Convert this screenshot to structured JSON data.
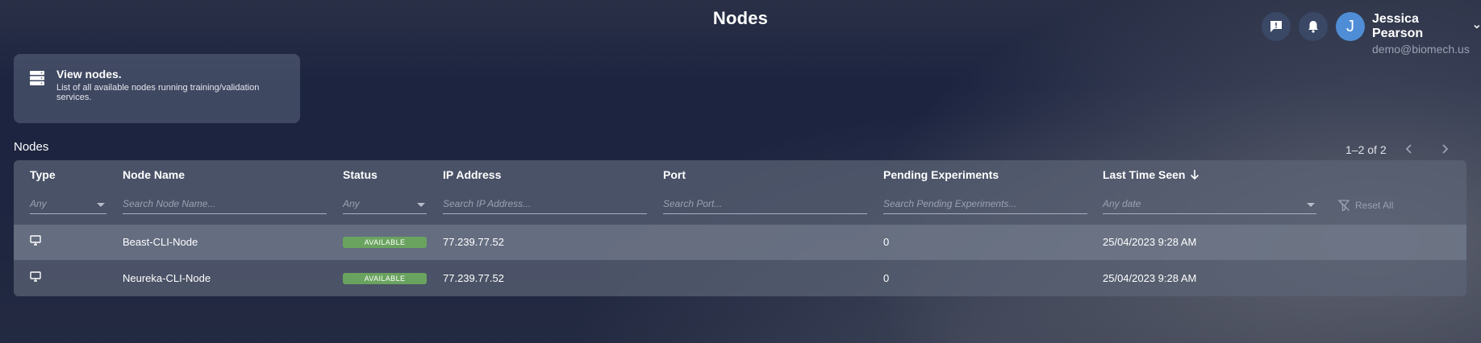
{
  "header": {
    "title": "Nodes",
    "user": {
      "name": "Jessica Pearson",
      "email": "demo@biomech.us",
      "initial": "J"
    }
  },
  "info_card": {
    "title": "View nodes.",
    "description": "List of all available nodes running training/validation services."
  },
  "section": {
    "title": "Nodes"
  },
  "pagination": {
    "range": "1–2 of 2"
  },
  "table": {
    "columns": [
      "Type",
      "Node Name",
      "Status",
      "IP Address",
      "Port",
      "Pending Experiments",
      "Last Time Seen"
    ],
    "filters": {
      "type": "Any",
      "node_name": "Search Node Name...",
      "status": "Any",
      "ip": "Search IP Address...",
      "port": "Search Port...",
      "pending": "Search Pending Experiments...",
      "date": "Any date"
    },
    "reset_label": "Reset All",
    "rows": [
      {
        "type_icon": "monitor-icon",
        "name": "Beast-CLI-Node",
        "status": "AVAILABLE",
        "ip": "77.239.77.52",
        "port": "",
        "pending": "0",
        "last_seen": "25/04/2023 9:28 AM"
      },
      {
        "type_icon": "monitor-icon",
        "name": "Neureka-CLI-Node",
        "status": "AVAILABLE",
        "ip": "77.239.77.52",
        "port": "",
        "pending": "0",
        "last_seen": "25/04/2023 9:28 AM"
      }
    ]
  },
  "colors": {
    "status_available": "#6aa35f",
    "avatar": "#4f8ed6"
  }
}
